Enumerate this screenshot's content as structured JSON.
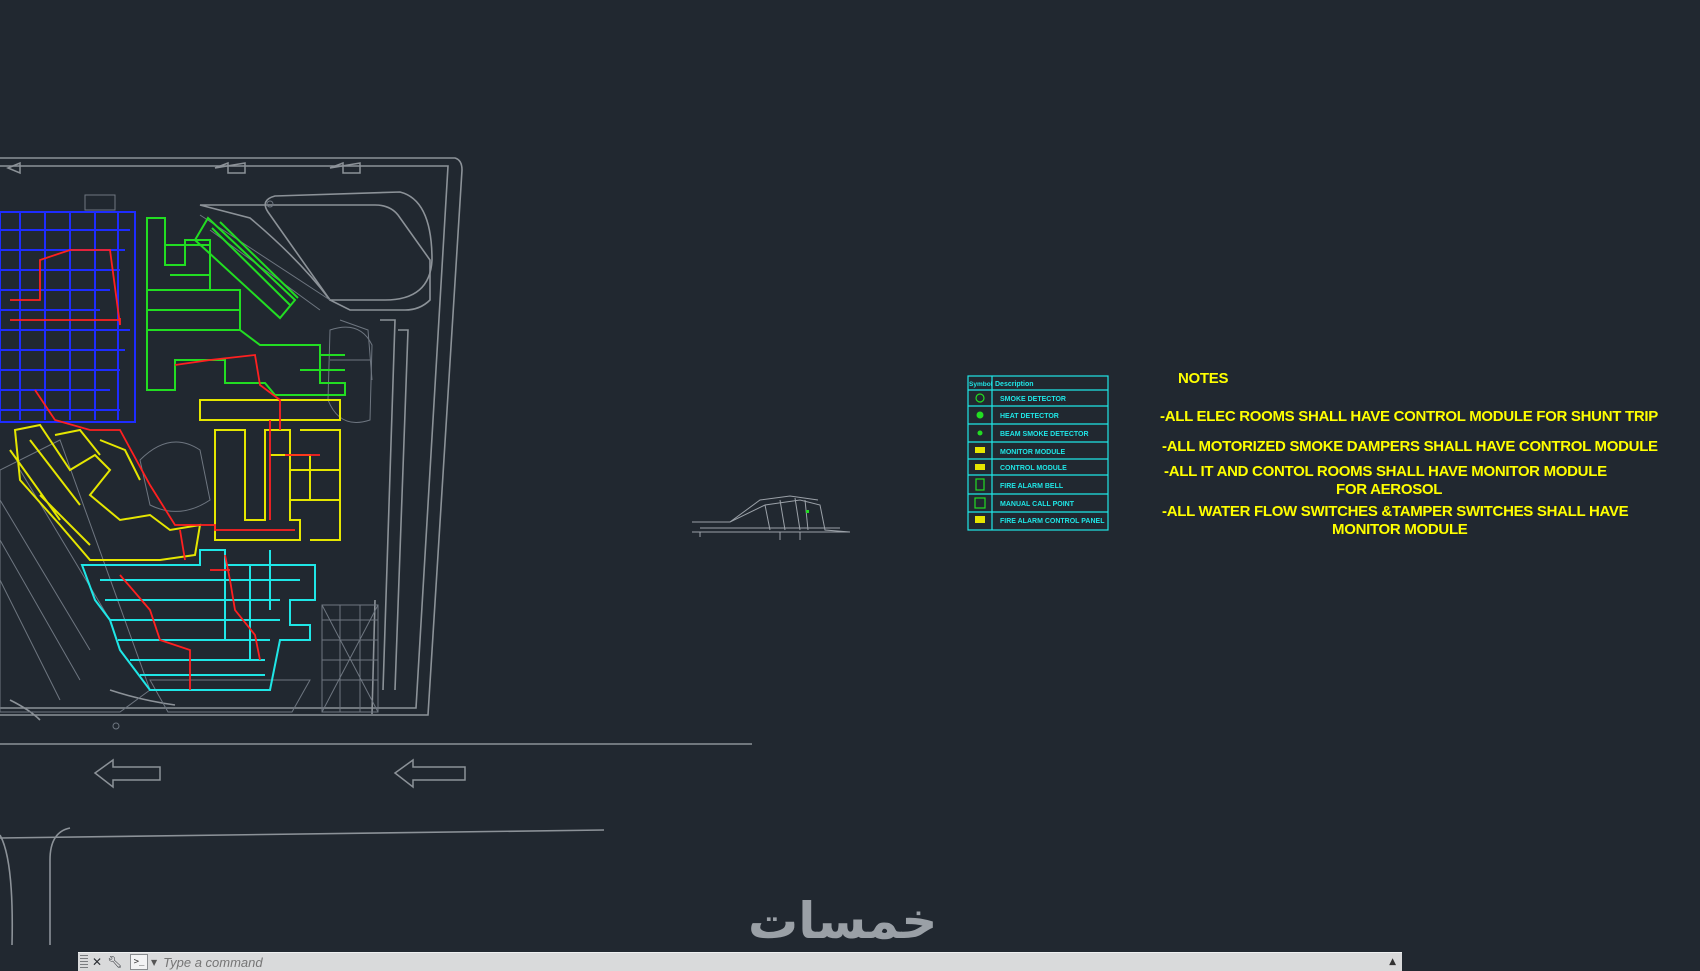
{
  "legend": {
    "header": [
      "Symbol",
      "Description"
    ],
    "rows": [
      "SMOKE DETECTOR",
      "HEAT DETECTOR",
      "BEAM SMOKE DETECTOR",
      "MONITOR MODULE",
      "CONTROL MODULE",
      "FIRE ALARM BELL",
      "MANUAL CALL POINT",
      "FIRE ALARM CONTROL PANEL"
    ]
  },
  "notes": {
    "title": "NOTES",
    "lines": [
      "-ALL ELEC ROOMS SHALL HAVE CONTROL MODULE FOR SHUNT TRIP",
      "-ALL MOTORIZED SMOKE DAMPERS SHALL HAVE CONTROL MODULE",
      "-ALL IT AND CONTOL ROOMS SHALL HAVE MONITOR MODULE",
      "FOR AEROSOL",
      "-ALL   WATER FLOW SWITCHES &TAMPER SWITCHES   SHALL HAVE",
      "MONITOR MODULE"
    ]
  },
  "watermark": "خمسات",
  "command_line": {
    "placeholder": "Type a command",
    "close_icon": "close-icon",
    "customize_icon": "wrench-icon",
    "recent_icon": "prompt-icon",
    "expand_icon": "chevron-up-icon"
  },
  "colors": {
    "background": "#212830",
    "boundary": "#8c9298",
    "blue_zone": "#1e2cff",
    "green_zone": "#22dd22",
    "yellow_zone": "#e5e600",
    "cyan_zone": "#1fe6e6",
    "wiring": "#ff2020",
    "legend": "#1fe6e6",
    "notes": "#ffff00"
  }
}
